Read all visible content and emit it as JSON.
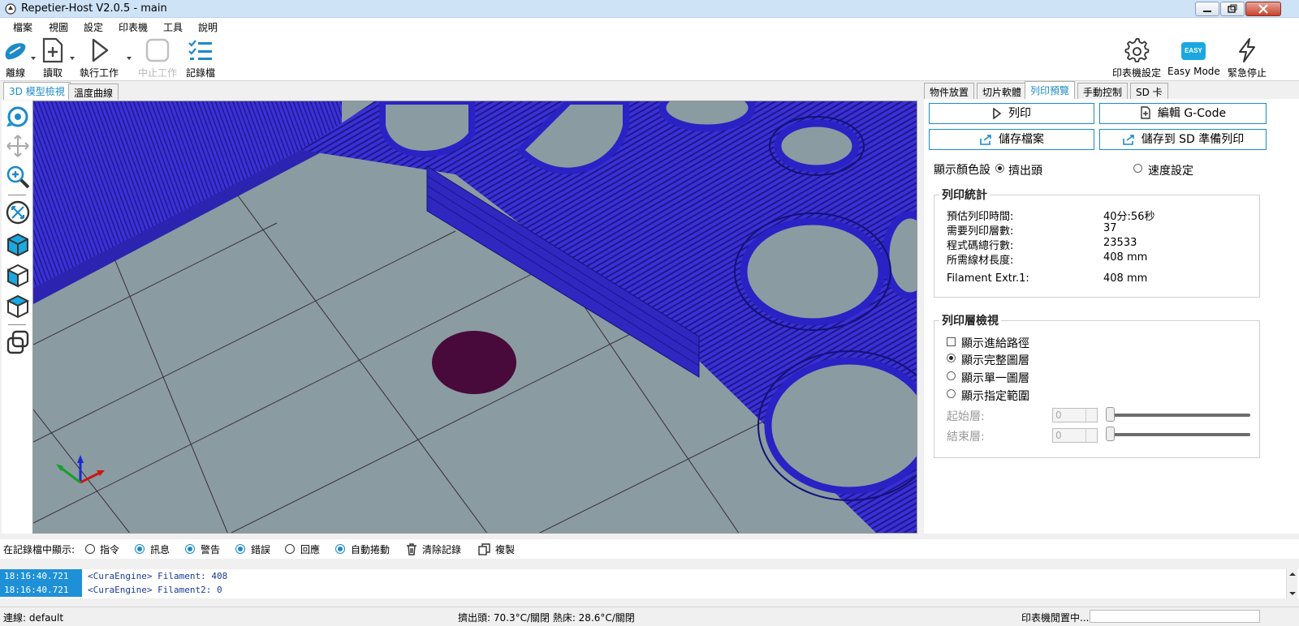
{
  "window": {
    "title": "Repetier-Host V2.0.5 - main"
  },
  "menu": [
    "檔案",
    "視圖",
    "設定",
    "印表機",
    "工具",
    "說明"
  ],
  "toolbar": {
    "connect": "離線",
    "load": "讀取",
    "run": "執行工作",
    "stop": "中止工作",
    "log": "記錄檔",
    "printer_settings": "印表機設定",
    "easy_mode": "Easy Mode",
    "easy_badge": "EASY",
    "emergency": "緊急停止"
  },
  "view_tabs": [
    "3D 模型檢視",
    "溫度曲線"
  ],
  "right_tabs": [
    "物件放置",
    "切片軟體",
    "列印預覽",
    "手動控制",
    "SD 卡"
  ],
  "right_active_tab": "列印預覽",
  "actions": {
    "print": "列印",
    "edit_gcode": "編輯 G-Code",
    "save_file": "儲存檔案",
    "save_sd": "儲存到 SD 準備列印"
  },
  "color_mode": {
    "label": "顯示顏色設",
    "extruder": "擠出頭",
    "speed": "速度設定",
    "selected": "extruder"
  },
  "stats": {
    "title": "列印統計",
    "rows": [
      {
        "label": "預估列印時間:",
        "value": "40分:56秒"
      },
      {
        "label": "需要列印層數:",
        "value": "37"
      },
      {
        "label": "程式碼總行數:",
        "value": "23533"
      },
      {
        "label": "所需線材長度:",
        "value": "408 mm"
      },
      {
        "label": "Filament Extr.1:",
        "value": "408 mm"
      }
    ]
  },
  "layer_view": {
    "title": "列印層檢視",
    "show_travel": "顯示進給路徑",
    "options": [
      "顯示完整圖層",
      "顯示單一圖層",
      "顯示指定範圍"
    ],
    "selected_index": 0,
    "start_label": "起始層:",
    "end_label": "結束層:",
    "start_value": "0",
    "end_value": "0"
  },
  "log_filter": {
    "label": "在記錄檔中顯示:",
    "options": [
      {
        "label": "指令",
        "on": false
      },
      {
        "label": "訊息",
        "on": true
      },
      {
        "label": "警告",
        "on": true
      },
      {
        "label": "錯誤",
        "on": true
      },
      {
        "label": "回應",
        "on": false
      },
      {
        "label": "自動捲動",
        "on": true
      }
    ],
    "clear": "清除記錄",
    "copy": "複製"
  },
  "log_lines": [
    {
      "time": "18:16:40.721",
      "msg": "<CuraEngine> Filament: 408"
    },
    {
      "time": "18:16:40.721",
      "msg": "<CuraEngine> Filament2: 0"
    }
  ],
  "status": {
    "connection": "連線: default",
    "temps": "擠出頭: 70.3°C/關閉 熱床: 28.6°C/關閉",
    "printer_state": "印表機閒置中..."
  },
  "colors": {
    "accent": "#1c8ac9",
    "model": "#3a2fd0",
    "bed": "#8a9ca1"
  }
}
